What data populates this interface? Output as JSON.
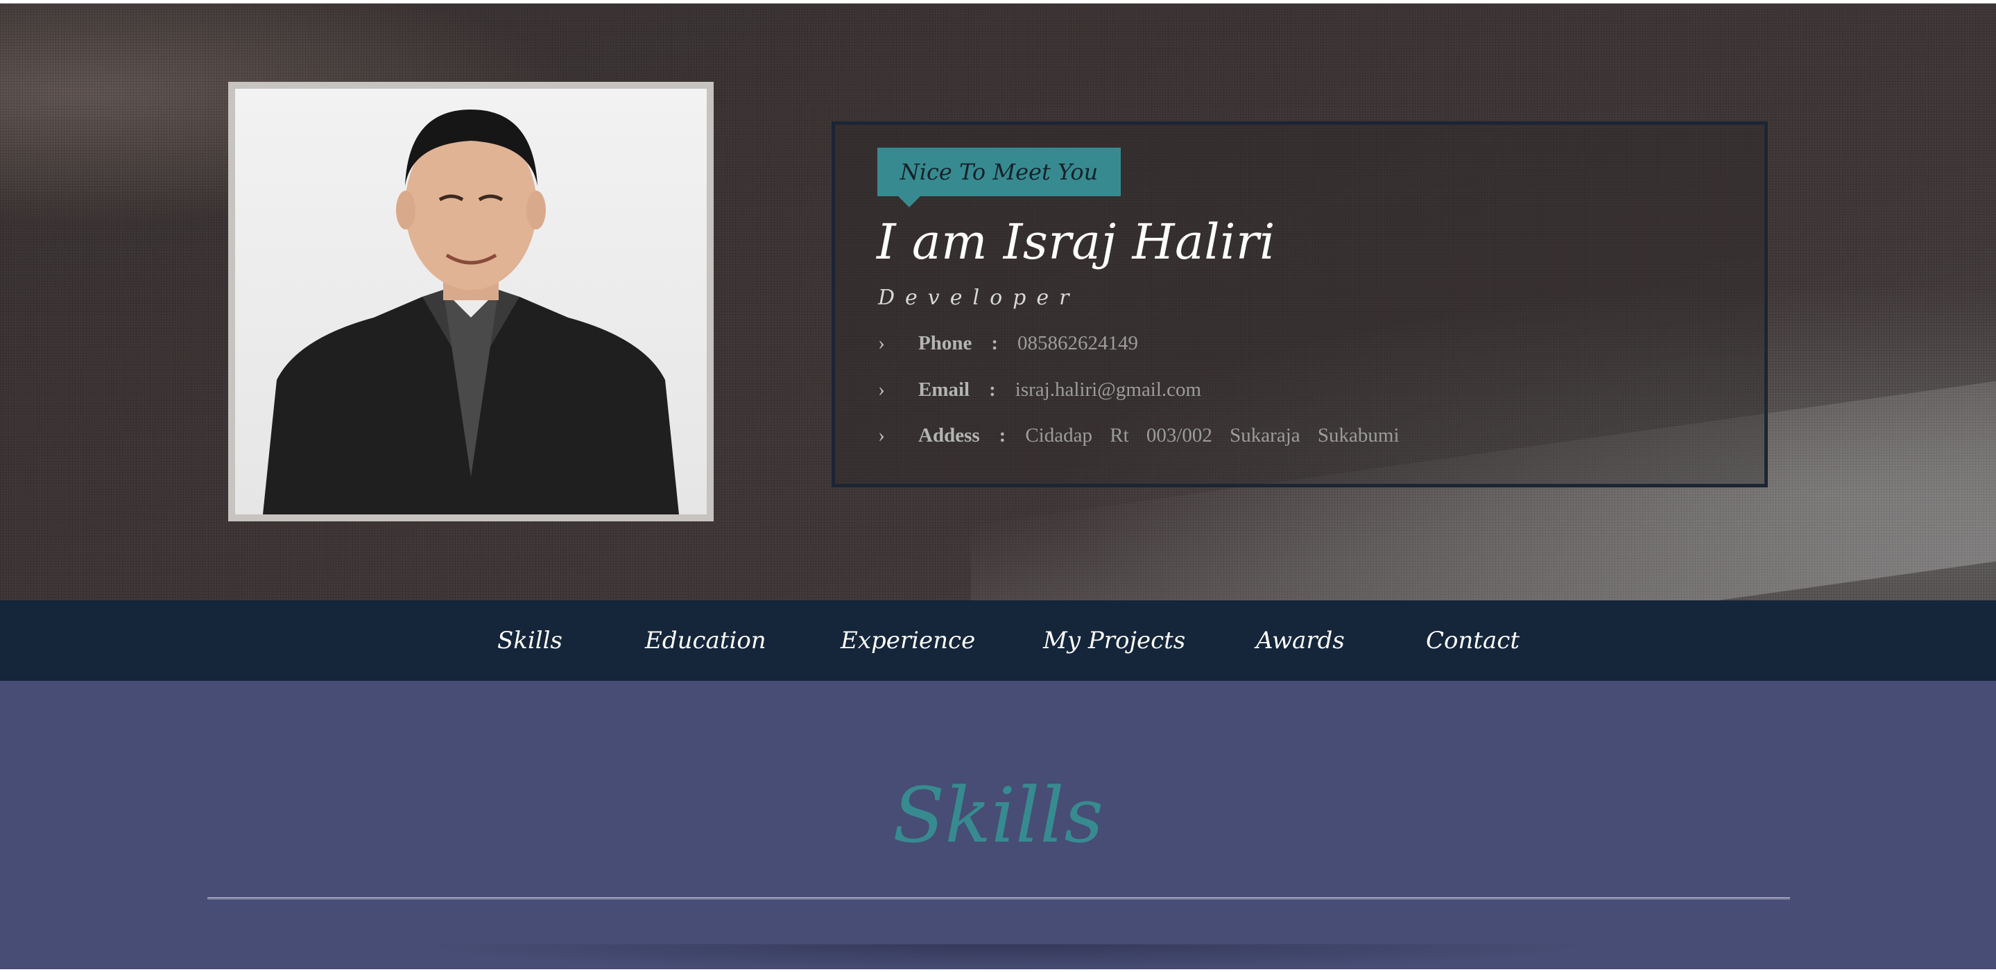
{
  "hero": {
    "greeting": "Nice To Meet You",
    "name": "I am Israj Haliri",
    "role": "Developer",
    "info": [
      {
        "label": "Phone",
        "value": "085862624149"
      },
      {
        "label": "Email",
        "value": "israj.haliri@gmail.com"
      },
      {
        "label": "Addess",
        "value": "Cidadap Rt 003/002 Sukaraja Sukabumi"
      }
    ],
    "colon": ":",
    "chevron": "›"
  },
  "nav": {
    "items": [
      {
        "label": "Skills"
      },
      {
        "label": "Education"
      },
      {
        "label": "Experience"
      },
      {
        "label": "My Projects"
      },
      {
        "label": "Awards"
      },
      {
        "label": "Contact"
      }
    ]
  },
  "section": {
    "title": "Skills"
  },
  "colors": {
    "accent": "#378b90",
    "navbar": "#15253a",
    "section_bg": "#474d74"
  }
}
